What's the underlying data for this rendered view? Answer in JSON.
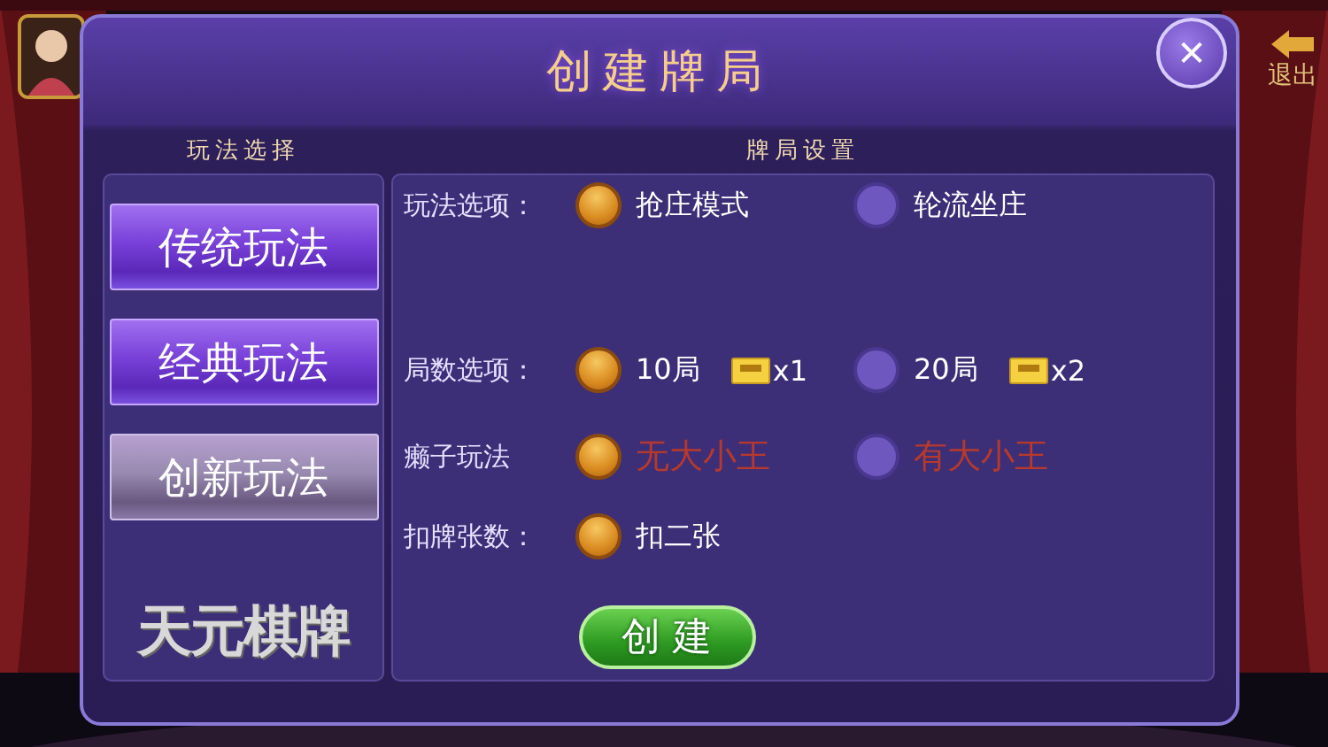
{
  "backdrop": {
    "exit_label": "退出"
  },
  "dialog": {
    "title": "创建牌局",
    "close": "✕"
  },
  "mode_panel": {
    "heading": "玩法选择",
    "modes": [
      {
        "label": "传统玩法",
        "selected": false
      },
      {
        "label": "经典玩法",
        "selected": false
      },
      {
        "label": "创新玩法",
        "selected": true
      }
    ],
    "brand": "天元棋牌"
  },
  "settings_panel": {
    "heading": "牌局设置",
    "rows": [
      {
        "label": "玩法选项：",
        "options": [
          {
            "text": "抢庄模式",
            "selected": true
          },
          {
            "text": "轮流坐庄",
            "selected": false
          }
        ]
      },
      {
        "label": "局数选项：",
        "options": [
          {
            "text": "10局",
            "selected": true,
            "cost": "x1"
          },
          {
            "text": "20局",
            "selected": false,
            "cost": "x2"
          }
        ]
      },
      {
        "label": "癞子玩法",
        "options": [
          {
            "text": "无大小王",
            "selected": true,
            "color": "#b8392b"
          },
          {
            "text": "有大小王",
            "selected": false,
            "color": "#b8392b"
          }
        ]
      },
      {
        "label": "扣牌张数：",
        "options": [
          {
            "text": "扣二张",
            "selected": true
          }
        ]
      }
    ],
    "create_button": "创 建"
  }
}
